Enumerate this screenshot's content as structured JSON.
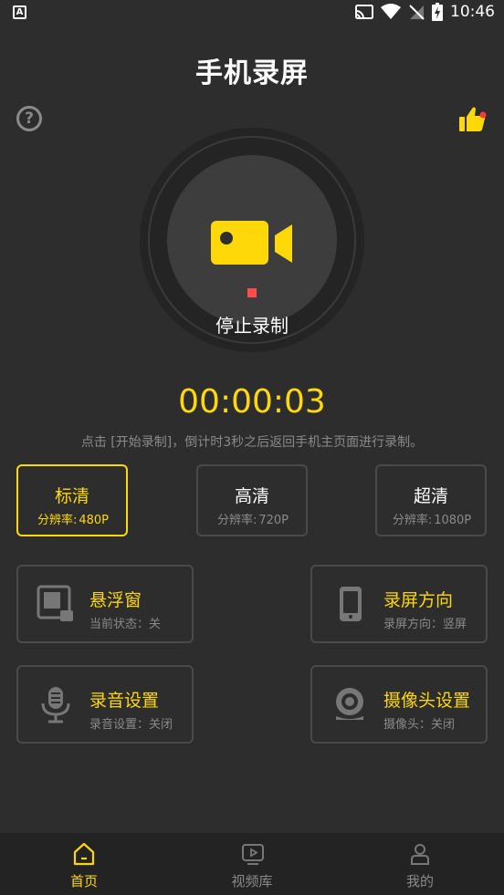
{
  "status_bar": {
    "time": "10:46",
    "left_icon": "A"
  },
  "header": {
    "title": "手机录屏",
    "help_glyph": "?"
  },
  "recorder": {
    "label": "停止录制"
  },
  "timer": "00:00:03",
  "hint": "点击 [开始录制]，倒计时3秒之后返回手机主页面进行录制。",
  "quality": [
    {
      "title": "标清",
      "sub_label": "分辨率:",
      "sub_value": "480P",
      "active": true
    },
    {
      "title": "高清",
      "sub_label": "分辨率:",
      "sub_value": "720P",
      "active": false
    },
    {
      "title": "超清",
      "sub_label": "分辨率:",
      "sub_value": "1080P",
      "active": false
    }
  ],
  "cards": {
    "float": {
      "title": "悬浮窗",
      "sub": "当前状态：关"
    },
    "orientation": {
      "title": "录屏方向",
      "sub": "录屏方向：竖屏"
    },
    "audio": {
      "title": "录音设置",
      "sub": "录音设置：关闭"
    },
    "camera": {
      "title": "摄像头设置",
      "sub": "摄像头：关闭"
    }
  },
  "tabs": [
    {
      "label": "首页",
      "active": true
    },
    {
      "label": "视频库",
      "active": false
    },
    {
      "label": "我的",
      "active": false
    }
  ],
  "colors": {
    "accent": "#ffd80a",
    "background": "#2d2d2d",
    "record_dot": "#ff4d4d",
    "muted": "#8a8a8a"
  }
}
